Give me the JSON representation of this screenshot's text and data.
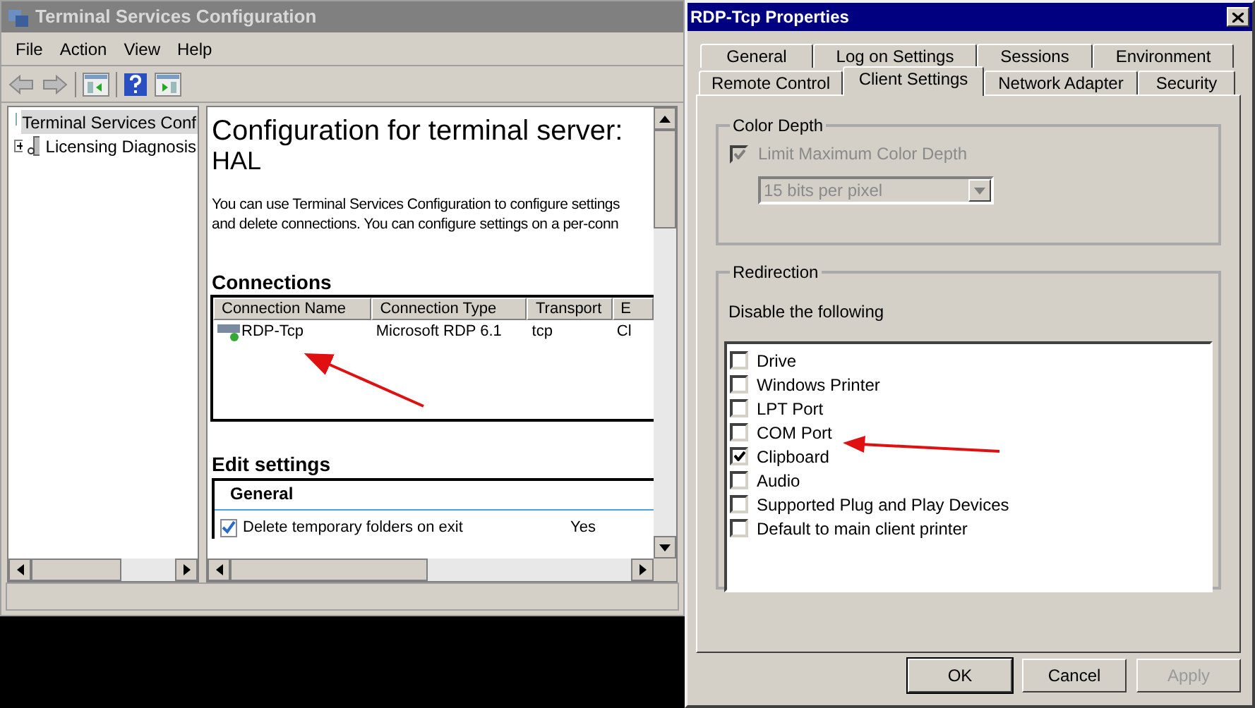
{
  "main_window": {
    "title": "Terminal Services Configuration",
    "menu": [
      "File",
      "Action",
      "View",
      "Help"
    ],
    "tree": [
      {
        "label": "Terminal Services Conf",
        "selected": true
      },
      {
        "label": "Licensing Diagnosis",
        "selected": false,
        "expanded": false
      }
    ],
    "heading": "Configuration for terminal server:",
    "server": "HAL",
    "description": [
      "You can use Terminal Services Configuration to configure settings",
      "and delete connections. You can configure settings on a per-conn"
    ],
    "connections": {
      "title": "Connections",
      "columns": [
        "Connection Name",
        "Connection Type",
        "Transport",
        "E"
      ],
      "rows": [
        [
          "RDP-Tcp",
          "Microsoft RDP 6.1",
          "tcp",
          "Cl"
        ]
      ]
    },
    "edit_settings": {
      "title": "Edit settings",
      "section": "General",
      "rows": [
        {
          "label": "Delete temporary folders on exit",
          "value": "Yes"
        }
      ]
    }
  },
  "dialog": {
    "title": "RDP-Tcp Properties",
    "tab_rows": [
      [
        {
          "label": "General",
          "selected": false
        },
        {
          "label": "Log on Settings",
          "selected": false
        },
        {
          "label": "Sessions",
          "selected": false
        },
        {
          "label": "Environment",
          "selected": false
        }
      ],
      [
        {
          "label": "Remote Control",
          "selected": false
        },
        {
          "label": "Client Settings",
          "selected": true
        },
        {
          "label": "Network Adapter",
          "selected": false
        },
        {
          "label": "Security",
          "selected": false
        }
      ]
    ],
    "color_depth": {
      "title": "Color Depth",
      "checkbox": {
        "label": "Limit Maximum Color Depth",
        "checked": true,
        "disabled": true
      },
      "dropdown": {
        "value": "15 bits per pixel",
        "disabled": true
      }
    },
    "redirection": {
      "title": "Redirection",
      "caption": "Disable the following",
      "items": [
        {
          "label": "Drive",
          "checked": false
        },
        {
          "label": "Windows Printer",
          "checked": false
        },
        {
          "label": "LPT Port",
          "checked": false
        },
        {
          "label": "COM Port",
          "checked": false
        },
        {
          "label": "Clipboard",
          "checked": true
        },
        {
          "label": "Audio",
          "checked": false
        },
        {
          "label": "Supported Plug and Play Devices",
          "checked": false
        },
        {
          "label": "Default to main client printer",
          "checked": false
        }
      ]
    },
    "buttons": [
      {
        "label": "OK",
        "disabled": false
      },
      {
        "label": "Cancel",
        "disabled": false
      },
      {
        "label": "Apply",
        "disabled": true
      }
    ]
  }
}
